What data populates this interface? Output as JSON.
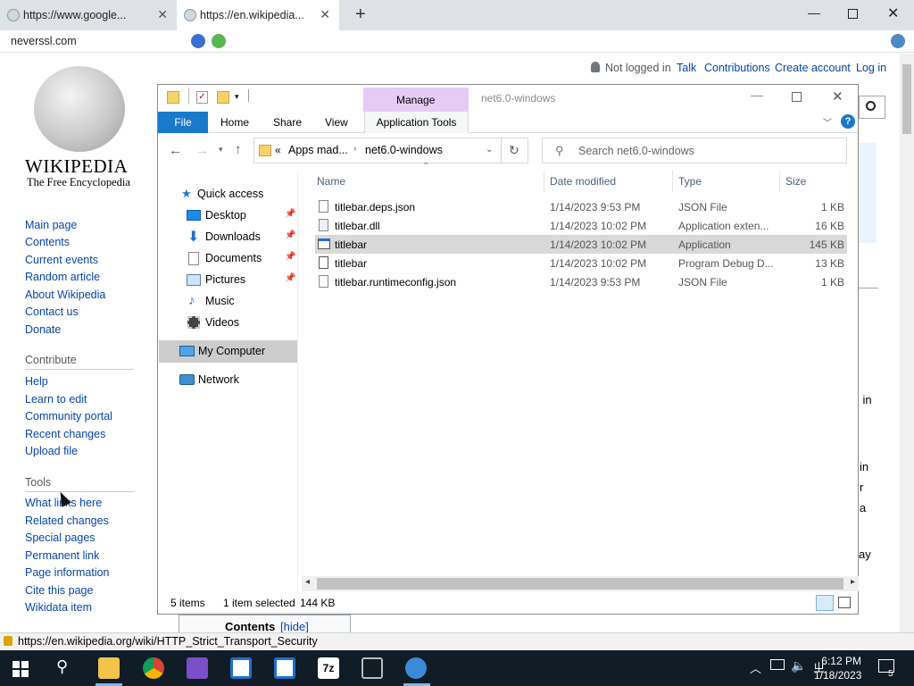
{
  "browser": {
    "tabs": [
      {
        "label": "https://www.google..."
      },
      {
        "label": "https://en.wikipedia..."
      }
    ],
    "address": "neverssl.com",
    "status_url": "https://en.wikipedia.org/wiki/HTTP_Strict_Transport_Security"
  },
  "wiki": {
    "user_links": [
      "Not logged in",
      "Talk",
      "Contributions",
      "Create account",
      "Log in"
    ],
    "logo_name": "WIKIPEDIA",
    "logo_tagline": "The Free Encyclopedia",
    "nav": [
      "Main page",
      "Contents",
      "Current events",
      "Random article",
      "About Wikipedia",
      "Contact us",
      "Donate"
    ],
    "contribute_heading": "Contribute",
    "contribute": [
      "Help",
      "Learn to edit",
      "Community portal",
      "Recent changes",
      "Upload file"
    ],
    "tools_heading": "Tools",
    "tools": [
      "What links here",
      "Related changes",
      "Special pages",
      "Permanent link",
      "Page information",
      "Cite this page",
      "Wikidata item"
    ],
    "contents_label": "Contents",
    "contents_hide": "[hide]",
    "right_fragments": [
      "l in",
      "in",
      "r",
      "a",
      "ay"
    ]
  },
  "explorer": {
    "title": "net6.0-windows",
    "manage": "Manage",
    "ribbon_tabs": [
      "File",
      "Home",
      "Share",
      "View",
      "Application Tools"
    ],
    "path": {
      "prefix": "«",
      "crumbs": [
        "Apps mad...",
        "net6.0-windows"
      ]
    },
    "search_placeholder": "Search net6.0-windows",
    "nav_pane": [
      {
        "label": "Quick access",
        "icon": "star-icon"
      },
      {
        "label": "Desktop",
        "icon": "desktop-icon",
        "pinned": true
      },
      {
        "label": "Downloads",
        "icon": "download-icon",
        "pinned": true
      },
      {
        "label": "Documents",
        "icon": "documents-icon",
        "pinned": true
      },
      {
        "label": "Pictures",
        "icon": "pictures-icon",
        "pinned": true
      },
      {
        "label": "Music",
        "icon": "music-icon"
      },
      {
        "label": "Videos",
        "icon": "videos-icon"
      },
      {
        "label": "My Computer",
        "icon": "computer-icon",
        "selected": true
      },
      {
        "label": "Network",
        "icon": "network-icon"
      }
    ],
    "columns": [
      "Name",
      "Date modified",
      "Type",
      "Size"
    ],
    "files": [
      {
        "name": "titlebar.deps.json",
        "date": "1/14/2023 9:53 PM",
        "type": "JSON File",
        "size": "1 KB"
      },
      {
        "name": "titlebar.dll",
        "date": "1/14/2023 10:02 PM",
        "type": "Application exten...",
        "size": "16 KB"
      },
      {
        "name": "titlebar",
        "date": "1/14/2023 10:02 PM",
        "type": "Application",
        "size": "145 KB",
        "selected": true
      },
      {
        "name": "titlebar",
        "date": "1/14/2023 10:02 PM",
        "type": "Program Debug D...",
        "size": "13 KB"
      },
      {
        "name": "titlebar.runtimeconfig.json",
        "date": "1/14/2023 9:53 PM",
        "type": "JSON File",
        "size": "1 KB"
      }
    ],
    "status": {
      "count": "5 items",
      "selected": "1 item selected",
      "size": "144 KB"
    }
  },
  "taskbar": {
    "time": "6:12 PM",
    "date": "1/18/2023",
    "notif": "5"
  },
  "colors": {
    "accent": "#1979ca",
    "manage": "#e6ccf5",
    "taskbar": "#101c26",
    "link": "#0645ad"
  }
}
